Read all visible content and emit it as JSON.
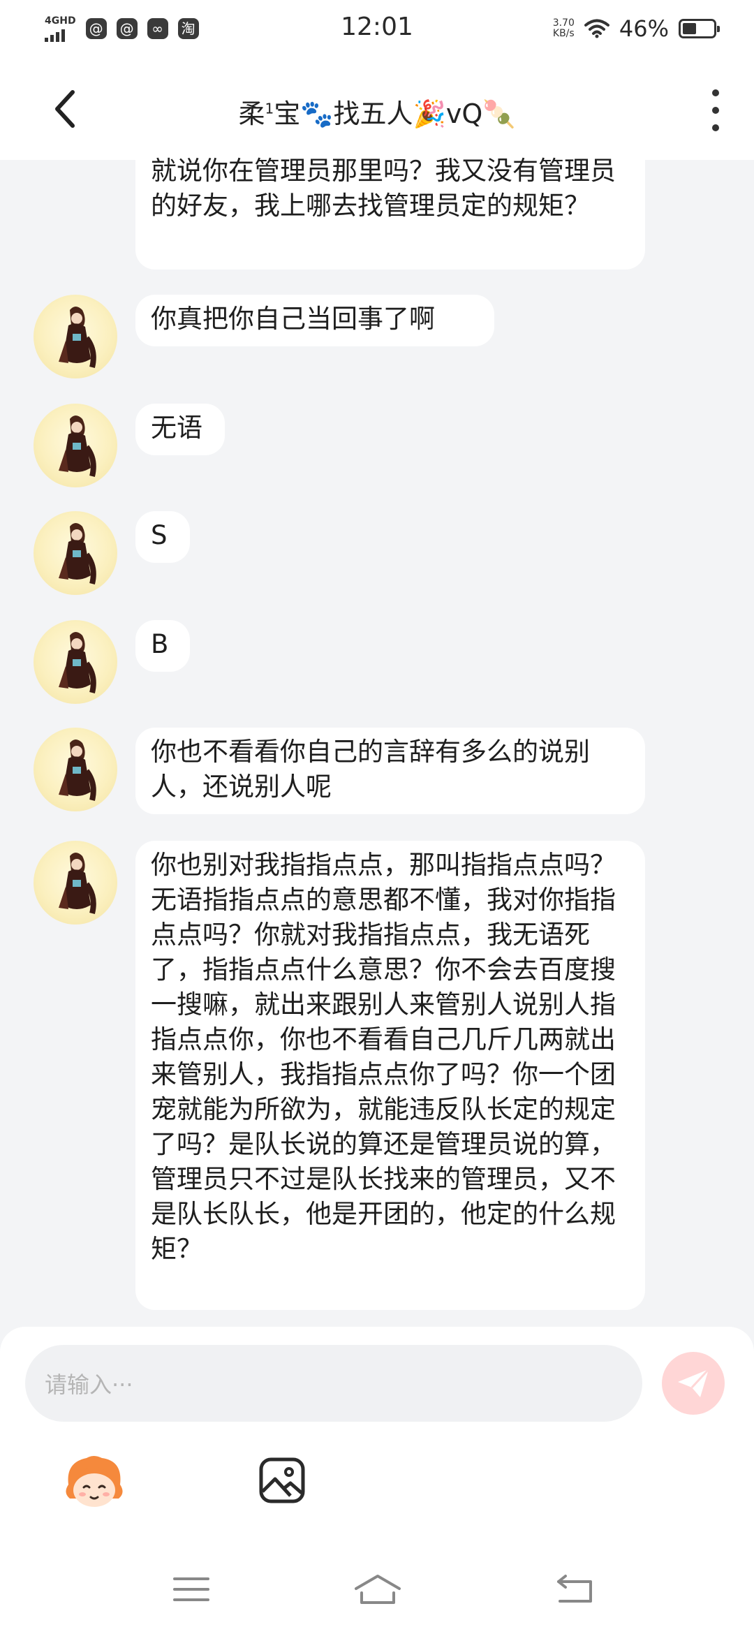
{
  "status_bar": {
    "network": "4GHD",
    "time": "12:01",
    "net_speed_value": "3.70",
    "net_speed_unit": "KB/s",
    "battery_percent": "46%",
    "battery_level": 0.46,
    "app_icons": [
      "at-icon",
      "at-icon",
      "link-icon",
      "taobao-icon"
    ],
    "taobao_char": "淘"
  },
  "header": {
    "title_part1": "柔",
    "title_sup": "1",
    "title_part2": "宝🐾找五人🎉vQ🍡"
  },
  "messages": [
    {
      "text": "就说你在管理员那里吗？我又没有管理员的好友，我上哪去找管理员定的规矩？",
      "has_avatar": false
    },
    {
      "text": "你真把你自己当回事了啊",
      "has_avatar": true
    },
    {
      "text": "无语",
      "has_avatar": true
    },
    {
      "text": "S",
      "has_avatar": true
    },
    {
      "text": "B",
      "has_avatar": true
    },
    {
      "text": "你也不看看你自己的言辞有多么的说别人，还说别人呢",
      "has_avatar": true
    },
    {
      "text": "你也别对我指指点点，那叫指指点点吗？无语指指点点的意思都不懂，我对你指指点点吗？你就对我指指点点，我无语死了，指指点点什么意思？你不会去百度搜一搜嘛，就出来跟别人来管别人说别人指指点点你，你也不看看自己几斤几两就出来管别人，我指指点点你了吗？你一个团宠就能为所欲为，就能违反队长定的规定了吗？是队长说的算还是管理员说的算，管理员只不过是队长找来的管理员，又不是队长队长，他是开团的，他定的什么规矩？",
      "has_avatar": true
    }
  ],
  "input": {
    "placeholder": "请输入···"
  },
  "colors": {
    "background": "#f3f4f6",
    "bubble": "#ffffff",
    "send_button": "#ffd6d6",
    "send_icon": "#ffffff",
    "avatar_bg": "#fbf0bf"
  },
  "icons": {
    "back": "chevron-left-icon",
    "more": "more-vertical-icon",
    "send": "send-icon",
    "emoji": "mascot-emoji-icon",
    "image": "image-icon",
    "nav": [
      "menu-icon",
      "home-icon",
      "back-nav-icon"
    ]
  }
}
